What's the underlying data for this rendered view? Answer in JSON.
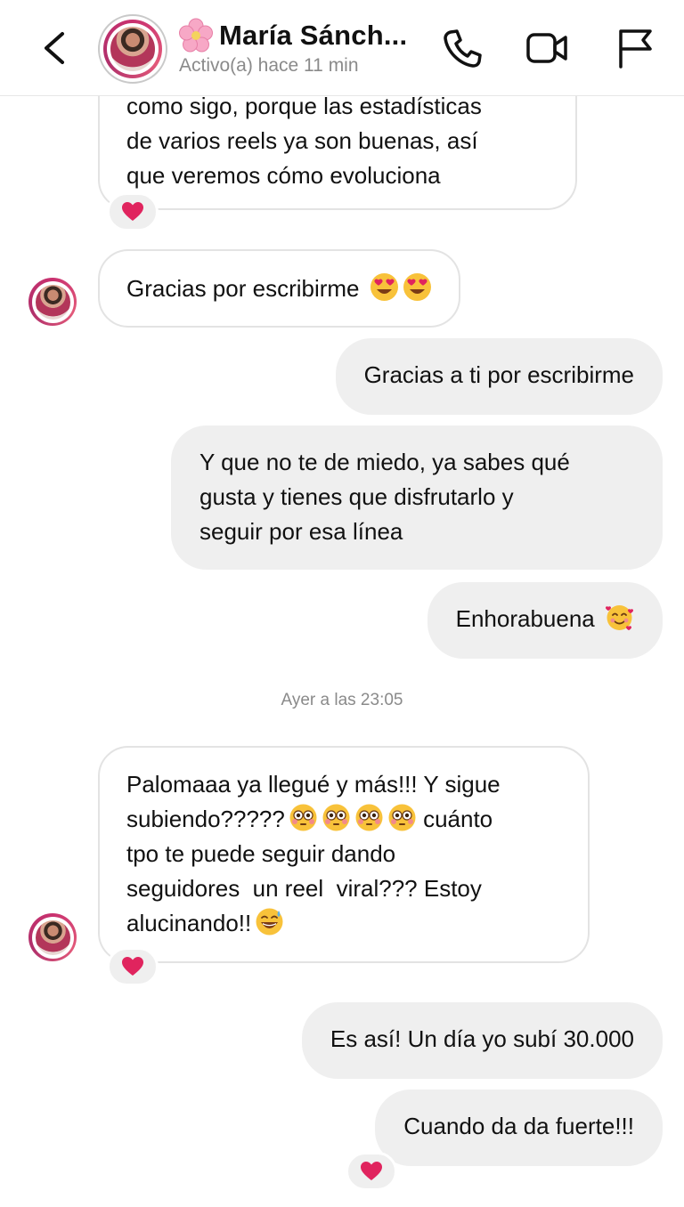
{
  "header": {
    "contact_name": "María Sánch...",
    "status": "Activo(a) hace 11 min",
    "icons": {
      "back": "chevron-left-icon",
      "phone": "phone-icon",
      "video": "video-camera-icon",
      "report": "flag-icon",
      "name_emoji": "cherry-blossom-emoji"
    }
  },
  "conversation": {
    "messages": [
      {
        "direction": "incoming",
        "text": "como sigo, porque las estadísticas\nde varios reels ya son buenas, así\nque veremos cómo evoluciona",
        "reaction": "❤️"
      },
      {
        "direction": "incoming",
        "text": "Gracias por escribirme",
        "emojis": [
          "heart-eyes-emoji",
          "heart-eyes-emoji"
        ]
      },
      {
        "direction": "outgoing",
        "text": "Gracias a ti por escribirme"
      },
      {
        "direction": "outgoing",
        "text": "Y que no te de miedo, ya sabes qué\ngusta y tienes que disfrutarlo y\nseguir por esa línea"
      },
      {
        "direction": "outgoing",
        "text": "Enhorabuena",
        "emojis": [
          "smiling-face-with-hearts-emoji"
        ]
      },
      {
        "direction": "incoming",
        "text_parts": [
          "Palomaaa ya llegué y más!!! Y sigue\nsubiendo?????",
          " cuánto\ntpo te puede seguir dando\nseguidores  un reel  viral??? Estoy\nalucinando!!"
        ],
        "emojis": [
          "flushed-face-emoji",
          "flushed-face-emoji",
          "flushed-face-emoji",
          "flushed-face-emoji",
          "grinning-sweat-emoji"
        ],
        "reaction": "❤️"
      },
      {
        "direction": "outgoing",
        "text": "Es así! Un día yo subí 30.000"
      },
      {
        "direction": "outgoing",
        "text": "Cuando da da fuerte!!!",
        "reaction": "❤️"
      }
    ],
    "timestamp": "Ayer a las 23:05"
  },
  "colors": {
    "incoming_bubble_border": "#e3e3e3",
    "outgoing_bubble": "#efefef",
    "story_ring": "#c9316f",
    "reaction_heart": "#e0245e",
    "status_text": "#8a8a8a"
  }
}
